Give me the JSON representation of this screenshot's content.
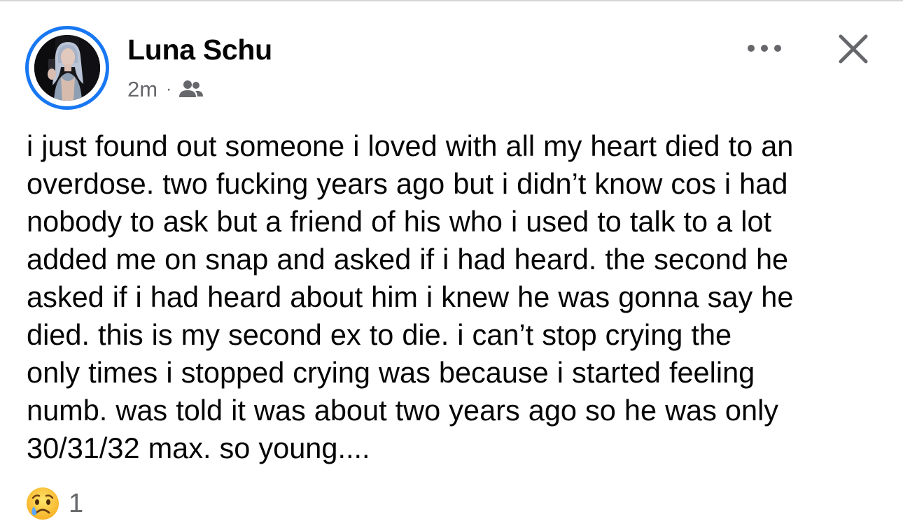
{
  "post": {
    "author": {
      "name": "Luna Schu",
      "story_ring_color": "#1877f2"
    },
    "meta": {
      "time": "2m",
      "separator": "·",
      "audience_icon": "friends-icon"
    },
    "header_actions": {
      "more_icon": "more-horizontal-icon",
      "close_icon": "close-icon"
    },
    "text_lines": [
      "i just found out someone i loved with all my heart died to an",
      "overdose. two fucking years ago but i didn’t know cos i had",
      "nobody to ask but a friend of his who i used to talk to a lot",
      "added me on snap and asked if i had heard. the second he",
      "asked if i had heard about him i knew he was gonna say he",
      "died. this is my second ex to die. i can’t stop crying the",
      "only times i stopped crying was because i started feeling",
      "numb. was told it was about two years ago so he was only",
      "30/31/32 max. so young...."
    ],
    "reactions": {
      "emoji_icon": "sad-crying-face-icon",
      "count": "1"
    }
  },
  "colors": {
    "text": "#050505",
    "secondary_text": "#65676b",
    "accent": "#1877f2",
    "background": "#ffffff"
  }
}
